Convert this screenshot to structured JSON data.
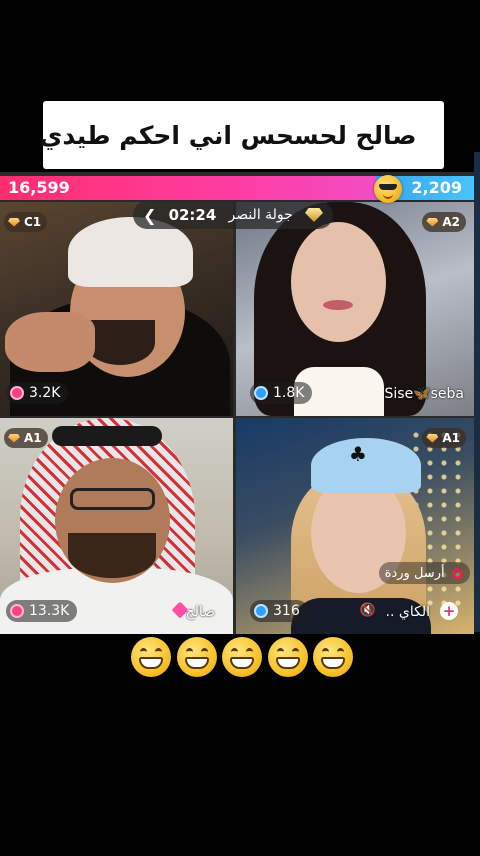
{
  "caption": {
    "text": "صالح لحسحس  اني احكم طيدي",
    "emoji": "😁"
  },
  "battle": {
    "score_left": "16,599",
    "score_right": "2,209",
    "timer": "02:24",
    "round_label": "جولة النصر"
  },
  "tiles": [
    {
      "rank": "C1",
      "viewers": "3.2K",
      "name": ""
    },
    {
      "rank": "A2",
      "viewers": "1.8K",
      "name": "Sise🦋seba"
    },
    {
      "rank": "A1",
      "viewers": "13.3K",
      "name": "صالح"
    },
    {
      "rank": "A1",
      "viewers": "316",
      "name": "الكاي ..",
      "gift_label": "أرسل وردة"
    }
  ],
  "reactions": [
    "😁",
    "😁",
    "😁",
    "😁",
    "😁"
  ],
  "colors": {
    "left_team": "#ff2f6d",
    "right_team": "#35a7f0"
  }
}
